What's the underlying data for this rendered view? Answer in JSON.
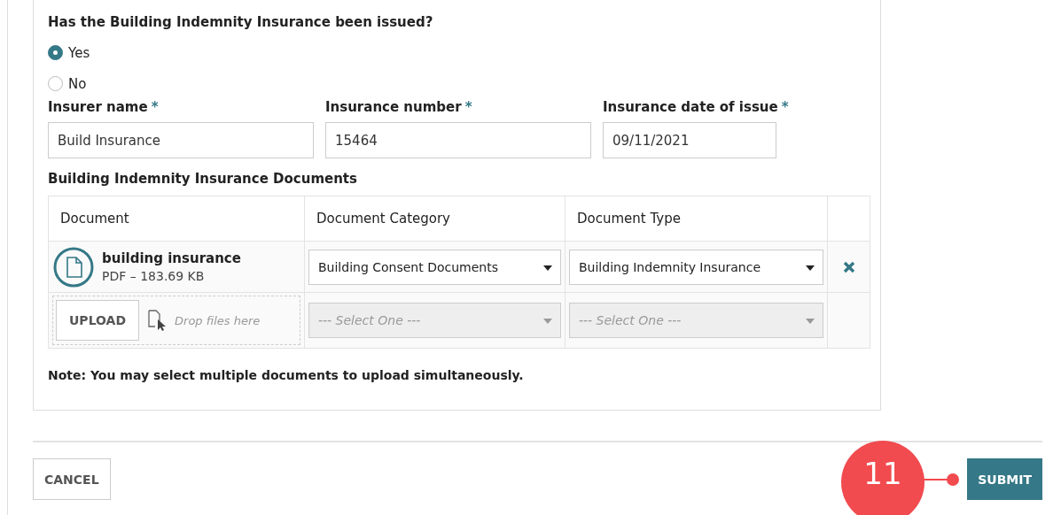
{
  "question": {
    "label": "Has the Building Indemnity Insurance been issued?",
    "options": [
      {
        "label": "Yes",
        "selected": true
      },
      {
        "label": "No",
        "selected": false
      }
    ]
  },
  "fields": [
    {
      "label": "Insurer name",
      "required_mark": "*",
      "value": "Build Insurance"
    },
    {
      "label": "Insurance number",
      "required_mark": "*",
      "value": "15464"
    },
    {
      "label": "Insurance date of issue",
      "required_mark": "*",
      "value": "09/11/2021"
    }
  ],
  "documents": {
    "title": "Building Indemnity Insurance Documents",
    "columns": [
      "Document",
      "Document Category",
      "Document Type"
    ],
    "rows": [
      {
        "name": "building insurance",
        "meta": "PDF – 183.69 KB",
        "category": "Building Consent Documents",
        "type": "Building Indemnity Insurance"
      }
    ],
    "upload": {
      "button": "UPLOAD",
      "drop_hint": "Drop files here",
      "category_placeholder": "--- Select One ---",
      "type_placeholder": "--- Select One ---",
      "disabled": true
    },
    "note": "Note: You may select multiple documents to upload simultaneously."
  },
  "buttons": {
    "cancel": "CANCEL",
    "submit": "SUBMIT"
  },
  "annotation": {
    "label": "11"
  }
}
